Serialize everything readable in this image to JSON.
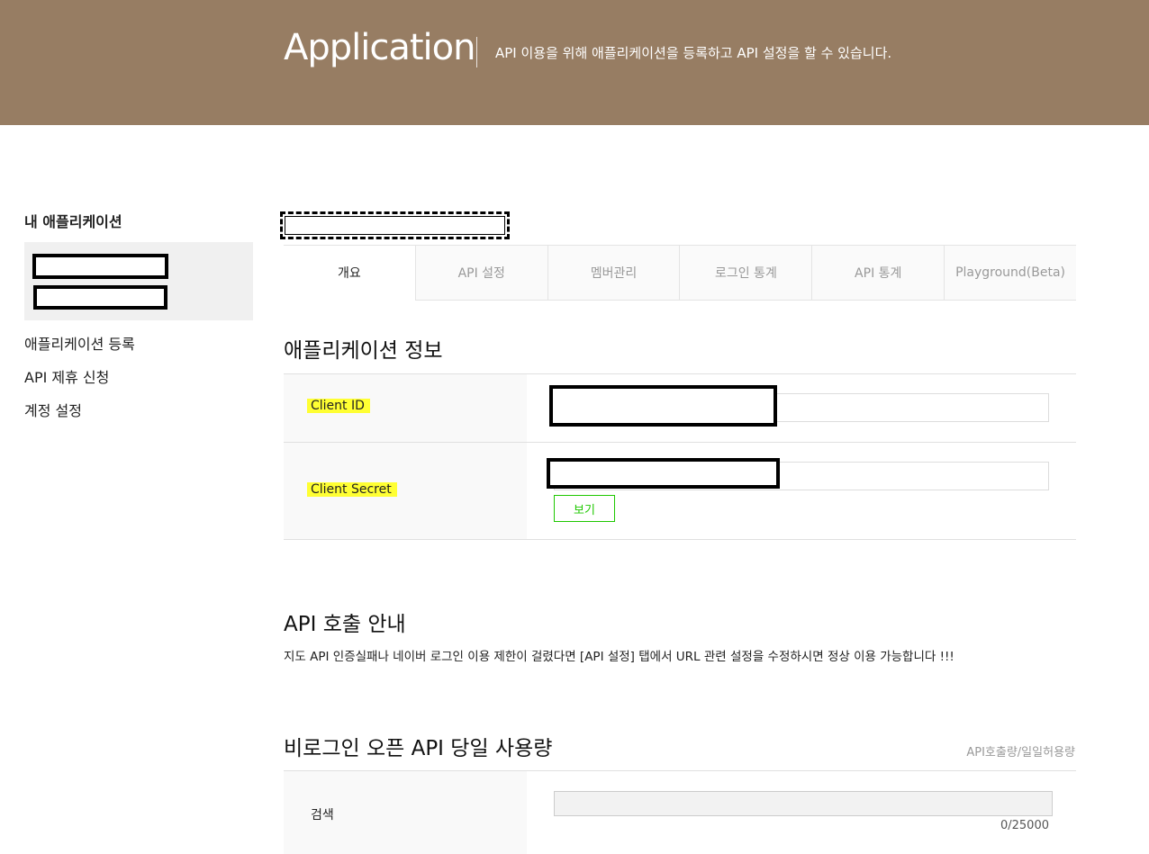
{
  "header": {
    "title": "Application",
    "description": "API 이용을 위해 애플리케이션을 등록하고 API 설정을 할 수 있습니다."
  },
  "sidebar": {
    "title": "내 애플리케이션",
    "links": [
      "애플리케이션 등록",
      "API 제휴 신청",
      "계정 설정"
    ]
  },
  "tabs": [
    "개요",
    "API 설정",
    "멤버관리",
    "로그인 통계",
    "API 통계",
    "Playground(Beta)"
  ],
  "app_info": {
    "title": "애플리케이션 정보",
    "client_id_label": "Client ID",
    "client_secret_label": "Client Secret",
    "view_button": "보기"
  },
  "api_guide": {
    "title": "API 호출 안내",
    "text": "지도 API 인증실패나 네이버 로그인 이용 제한이 걸렸다면 [API 설정] 탭에서 URL 관련 설정을 수정하시면 정상 이용 가능합니다 !!!"
  },
  "usage": {
    "title": "비로그인 오픈 API 당일 사용량",
    "note": "API호출량/일일허용량",
    "search_label": "검색",
    "search_count": "0/25000",
    "search_used_fraction": 0
  }
}
